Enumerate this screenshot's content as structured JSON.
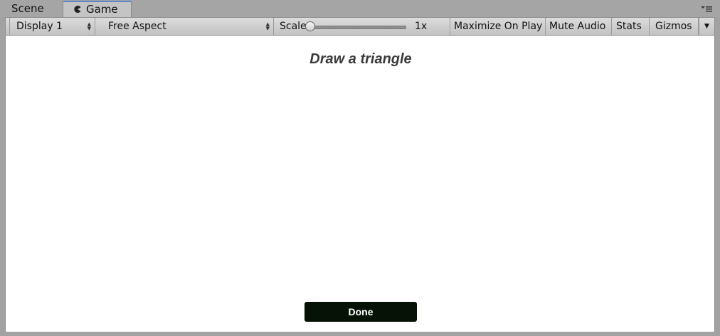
{
  "tabs": [
    {
      "label": "Scene",
      "active": false
    },
    {
      "label": "Game",
      "active": true
    }
  ],
  "toolbar": {
    "display": "Display 1",
    "aspect": "Free Aspect",
    "scale_label": "Scale",
    "scale_value": "1x",
    "maximize_on_play": "Maximize On Play",
    "mute_audio": "Mute Audio",
    "stats": "Stats",
    "gizmos": "Gizmos"
  },
  "game": {
    "prompt": "Draw a triangle",
    "done_label": "Done"
  },
  "colors": {
    "viewport_bg": "#ffffff",
    "done_button": "#061206",
    "active_tab_accent": "#5e87c5"
  },
  "icons": {
    "game_tab": "pacman-icon",
    "window_menu": "menu-icon"
  }
}
